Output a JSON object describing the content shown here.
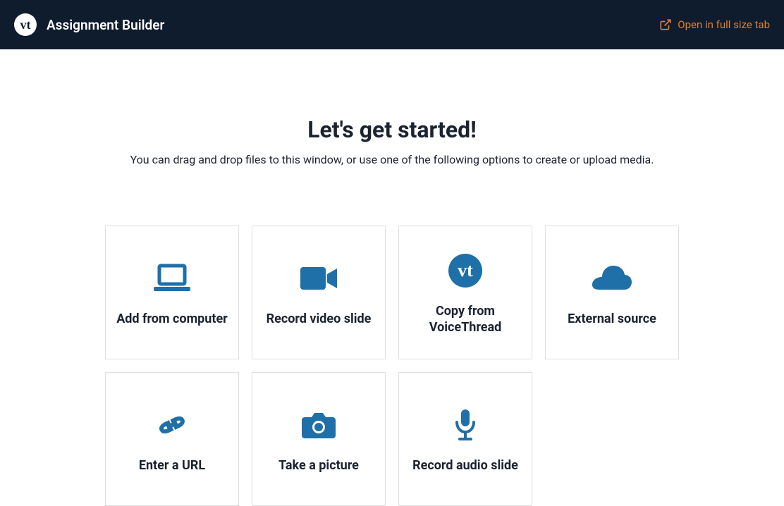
{
  "header": {
    "logo_text": "vt",
    "title": "Assignment Builder",
    "fullsize_label": "Open in full size tab"
  },
  "main": {
    "title": "Let's get started!",
    "subtitle": "You can drag and drop files to this window, or use one of the following options to create or upload media."
  },
  "cards": {
    "add_computer": "Add from computer",
    "record_video": "Record video slide",
    "copy_vt": "Copy from VoiceThread",
    "external_source": "External source",
    "enter_url": "Enter a URL",
    "take_picture": "Take a picture",
    "record_audio": "Record audio slide"
  },
  "vt_icon_text": "vt"
}
